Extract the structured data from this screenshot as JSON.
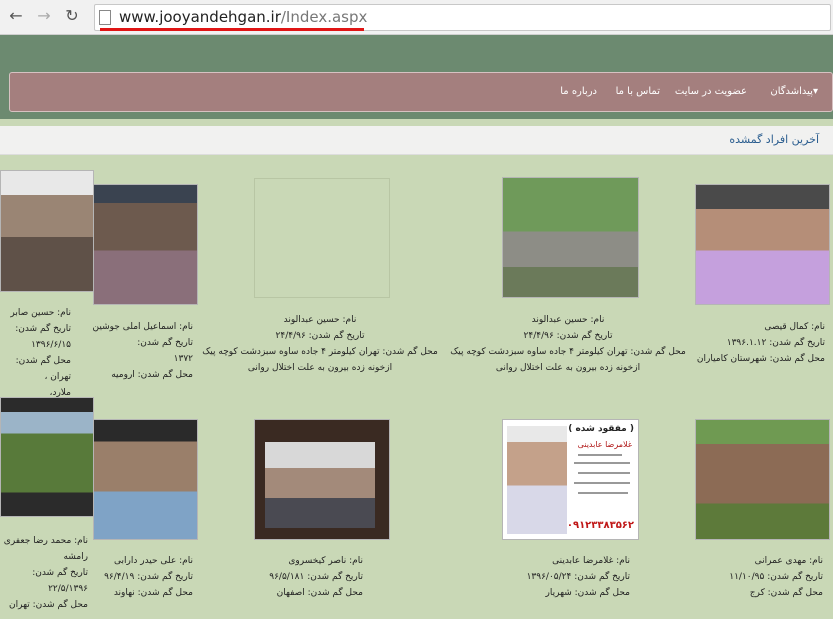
{
  "browser": {
    "url_domain": "www.jooyandehgan.ir",
    "url_path": "/Index.aspx",
    "back_glyph": "←",
    "forward_glyph": "→",
    "reload_glyph": "↻"
  },
  "nav": {
    "items": [
      "پیداشدگان▾",
      "عضویت در سایت",
      "تماس با ما",
      "درباره ما"
    ]
  },
  "section_title": "آخرین افراد گمشده",
  "row1": [
    {
      "l1": "نام: حسین صابر",
      "l2": "تاریخ گم شدن:",
      "l3": "۱۳۹۶/۶/۱۵",
      "l4": "محل گم شدن: تهران ،",
      "l5": "ملارد،"
    },
    {
      "l1": "نام: اسماعیل املی جوشین",
      "l2": "تاریخ گم شدن:",
      "l3": "۱۳۷۲",
      "l4": "محل گم شدن: ارومیه",
      "l5": ""
    },
    {
      "l1": "نام: حسین عبدالوند",
      "l2": "تاریخ گم شدن: ۲۴/۴/۹۶",
      "l3": "محل گم شدن: تهران کیلومتر ۴ جاده ساوه سبزدشت کوچه پیک",
      "l4": "ازخونه زده بیرون به علت اختلال روانی",
      "l5": ""
    },
    {
      "l1": "نام: حسین عبدالوند",
      "l2": "تاریخ گم شدن: ۲۴/۴/۹۶",
      "l3": "محل گم شدن: تهران کیلومتر ۴ جاده ساوه سبزدشت کوچه پیک",
      "l4": "ازخونه زده بیرون به علت اختلال روانی",
      "l5": ""
    },
    {
      "l1": "نام: کمال قیصی",
      "l2": "تاریخ گم شدن: ۱۳۹۶.۱.۱۲",
      "l3": "محل گم شدن: شهرستان کامیاران",
      "l4": "",
      "l5": ""
    }
  ],
  "row2": [
    {
      "l1": "نام: محمد رضا جعفری",
      "l2": "رامشه",
      "l3": "تاریخ گم شدن:",
      "l4": "۲۲/۵/۱۳۹۶",
      "l5": "محل گم شدن: تهران"
    },
    {
      "l1": "نام: علی حیدر دارابی",
      "l2": "تاریخ گم شدن: ۹۶/۴/۱۹",
      "l3": "محل گم شدن: نهاوند",
      "l4": "",
      "l5": ""
    },
    {
      "l1": "نام: ناصر کیخسروی",
      "l2": "تاریخ گم شدن: ۹۶/۵/۱۸۱",
      "l3": "محل گم شدن: اصفهان",
      "l4": "",
      "l5": ""
    },
    {
      "l1": "نام: غلامرضا عابدینی",
      "l2": "تاریخ گم شدن: ۱۳۹۶/۰۵/۲۴",
      "l3": "محل گم شدن: شهریار",
      "l4": "",
      "l5": ""
    },
    {
      "l1": "نام: مهدی عمرانی",
      "l2": "تاریخ گم شدن: ۱۱/۱۰/۹۵",
      "l3": "محل گم شدن: کرج",
      "l4": "",
      "l5": ""
    }
  ],
  "poster": {
    "title": "( مفقود شده )",
    "name": "غلامرضا عابدینی",
    "phone": "۰۹۱۲۳۳۸۳۵۶۲"
  }
}
